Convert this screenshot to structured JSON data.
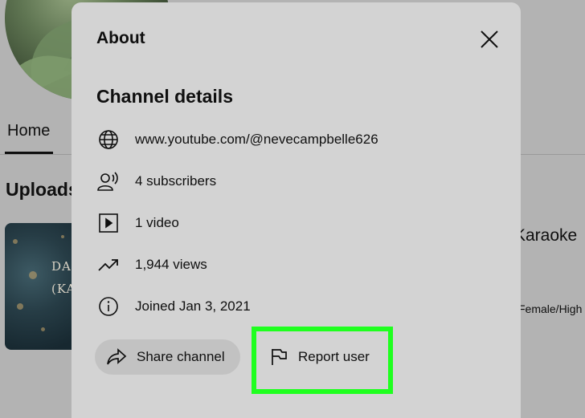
{
  "background": {
    "tab_home": "Home",
    "uploads_heading": "Uploads",
    "thumbnail_text": "DA E (KA",
    "video_title_fragment": "Karaoke",
    "video_meta_fragment": "Female/High"
  },
  "modal": {
    "title": "About",
    "section_title": "Channel details",
    "details": [
      {
        "icon": "globe-icon",
        "text": "www.youtube.com/@nevecampbelle626"
      },
      {
        "icon": "subscribers-icon",
        "text": "4 subscribers"
      },
      {
        "icon": "video-play-icon",
        "text": "1 video"
      },
      {
        "icon": "trending-icon",
        "text": "1,944 views"
      },
      {
        "icon": "info-icon",
        "text": "Joined Jan 3, 2021"
      }
    ],
    "share_button": "Share channel",
    "report_button": "Report user"
  },
  "colors": {
    "modal_bg": "#d3d3d3",
    "overlay_bg": "#b3b3b3",
    "highlight": "#1fff1f"
  }
}
